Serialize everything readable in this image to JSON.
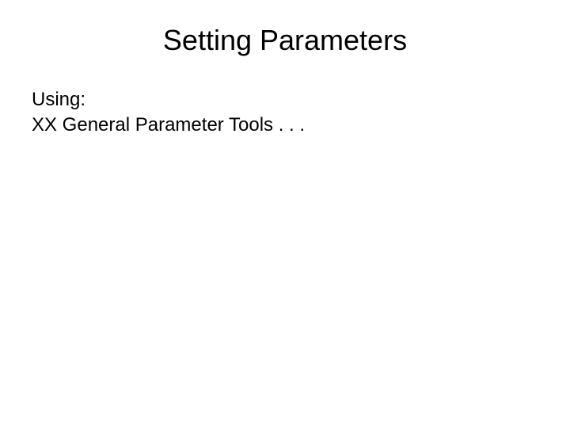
{
  "slide": {
    "title": "Setting Parameters",
    "body": {
      "line1": "Using:",
      "line2": "XX General Parameter Tools . . ."
    }
  }
}
